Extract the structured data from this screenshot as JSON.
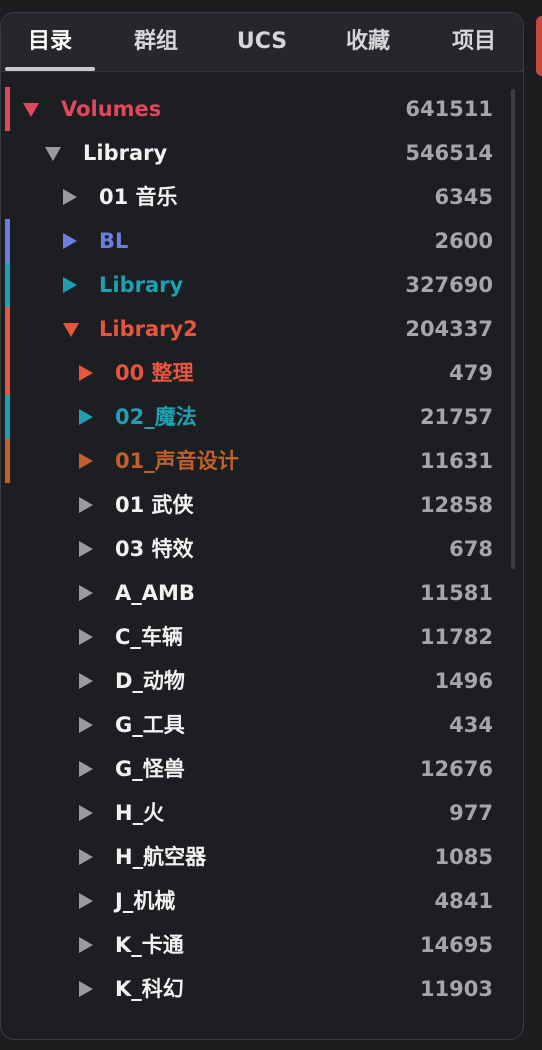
{
  "tabs": [
    {
      "label": "目录",
      "active": true
    },
    {
      "label": "群组",
      "active": false
    },
    {
      "label": "UCS",
      "active": false
    },
    {
      "label": "收藏",
      "active": false
    },
    {
      "label": "项目",
      "active": false
    }
  ],
  "tree": [
    {
      "label": "Volumes",
      "count": "641511",
      "level": 0,
      "expanded": true,
      "color": "#e0485e",
      "marker": "#e0485e"
    },
    {
      "label": "Library",
      "count": "546514",
      "level": 1,
      "expanded": true,
      "color": "#f2f2f2",
      "marker": null
    },
    {
      "label": "01 音乐",
      "count": "6345",
      "level": 2,
      "expanded": false,
      "color": "#f2f2f2",
      "marker": null
    },
    {
      "label": "BL",
      "count": "2600",
      "level": 2,
      "expanded": false,
      "color": "#6c7fe0",
      "marker": "#6c7fe0"
    },
    {
      "label": "Library",
      "count": "327690",
      "level": 2,
      "expanded": false,
      "color": "#1ea0b0",
      "marker": "#1ea0b0"
    },
    {
      "label": "Library2",
      "count": "204337",
      "level": 2,
      "expanded": true,
      "color": "#e8553f",
      "marker": "#e8553f"
    },
    {
      "label": "00 整理",
      "count": "479",
      "level": 3,
      "expanded": false,
      "color": "#e8553f",
      "marker": "#e8553f"
    },
    {
      "label": "02_魔法",
      "count": "21757",
      "level": 3,
      "expanded": false,
      "color": "#1ea0b0",
      "marker": "#1ea0b0"
    },
    {
      "label": "01_声音设计",
      "count": "11631",
      "level": 3,
      "expanded": false,
      "color": "#c0602a",
      "marker": "#c0602a"
    },
    {
      "label": "01 武侠",
      "count": "12858",
      "level": 3,
      "expanded": false,
      "color": "#f2f2f2",
      "marker": null
    },
    {
      "label": "03 特效",
      "count": "678",
      "level": 3,
      "expanded": false,
      "color": "#f2f2f2",
      "marker": null
    },
    {
      "label": "A_AMB",
      "count": "11581",
      "level": 3,
      "expanded": false,
      "color": "#f2f2f2",
      "marker": null
    },
    {
      "label": "C_车辆",
      "count": "11782",
      "level": 3,
      "expanded": false,
      "color": "#f2f2f2",
      "marker": null
    },
    {
      "label": "D_动物",
      "count": "1496",
      "level": 3,
      "expanded": false,
      "color": "#f2f2f2",
      "marker": null
    },
    {
      "label": "G_工具",
      "count": "434",
      "level": 3,
      "expanded": false,
      "color": "#f2f2f2",
      "marker": null
    },
    {
      "label": "G_怪兽",
      "count": "12676",
      "level": 3,
      "expanded": false,
      "color": "#f2f2f2",
      "marker": null
    },
    {
      "label": "H_火",
      "count": "977",
      "level": 3,
      "expanded": false,
      "color": "#f2f2f2",
      "marker": null
    },
    {
      "label": "H_航空器",
      "count": "1085",
      "level": 3,
      "expanded": false,
      "color": "#f2f2f2",
      "marker": null
    },
    {
      "label": "J_机械",
      "count": "4841",
      "level": 3,
      "expanded": false,
      "color": "#f2f2f2",
      "marker": null
    },
    {
      "label": "K_卡通",
      "count": "14695",
      "level": 3,
      "expanded": false,
      "color": "#f2f2f2",
      "marker": null
    },
    {
      "label": "K_科幻",
      "count": "11903",
      "level": 3,
      "expanded": false,
      "color": "#f2f2f2",
      "marker": null
    }
  ]
}
